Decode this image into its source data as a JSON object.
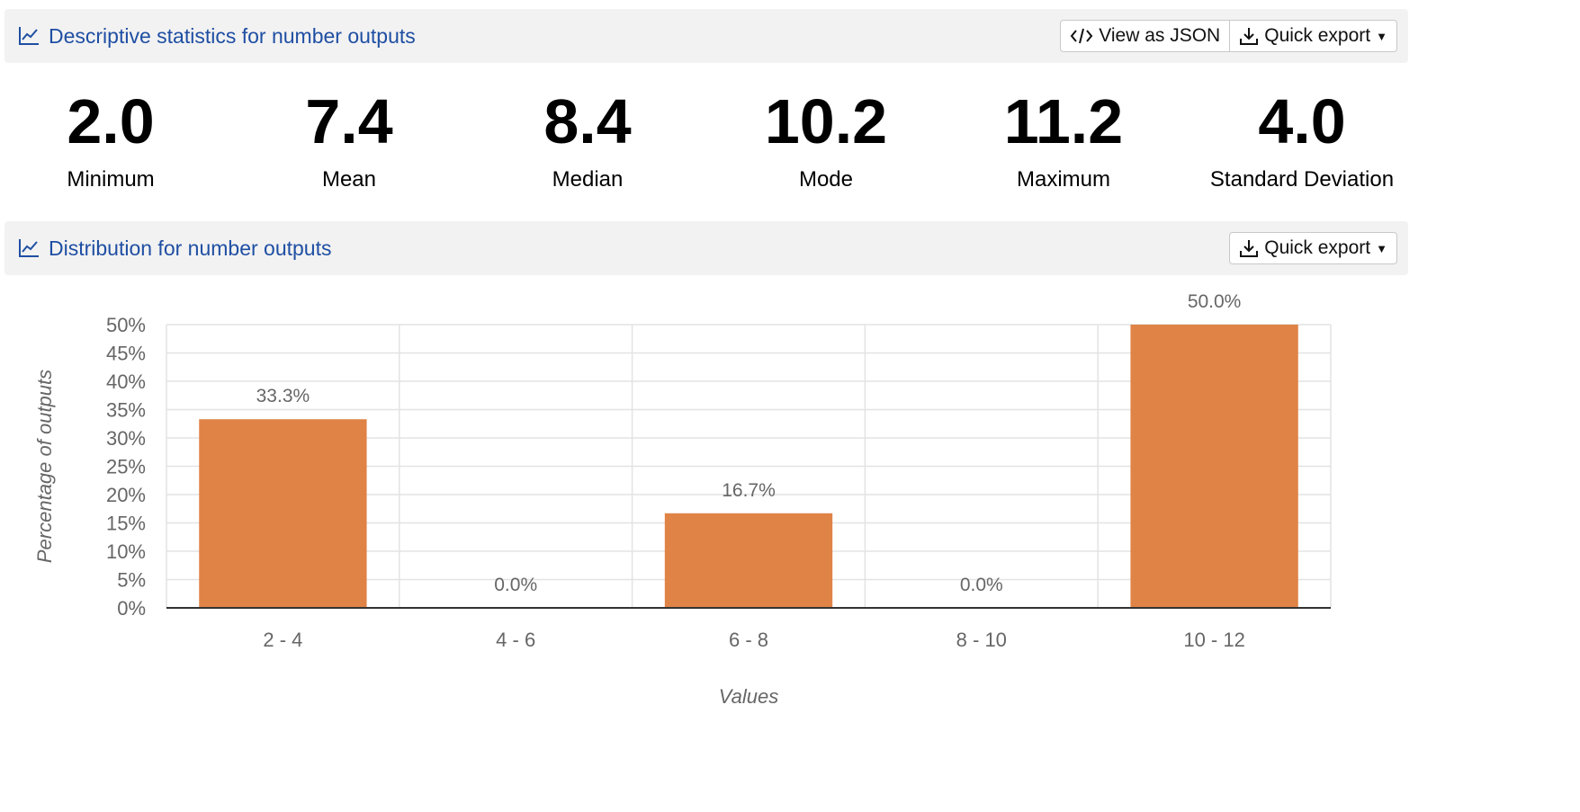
{
  "stats_panel": {
    "title": "Descriptive statistics for number outputs",
    "view_json_label": "View as JSON",
    "quick_export_label": "Quick export"
  },
  "stats": [
    {
      "value": "2.0",
      "label": "Minimum"
    },
    {
      "value": "7.4",
      "label": "Mean"
    },
    {
      "value": "8.4",
      "label": "Median"
    },
    {
      "value": "10.2",
      "label": "Mode"
    },
    {
      "value": "11.2",
      "label": "Maximum"
    },
    {
      "value": "4.0",
      "label": "Standard Deviation"
    }
  ],
  "distribution_panel": {
    "title": "Distribution for number outputs",
    "quick_export_label": "Quick export"
  },
  "colors": {
    "bar": "#e08347",
    "header_title": "#1f4fa3"
  },
  "icons": {
    "header": "line-chart-icon",
    "json": "code-icon",
    "export": "download-icon"
  },
  "chart_data": {
    "type": "bar",
    "categories": [
      "2 - 4",
      "4 - 6",
      "6 - 8",
      "8 - 10",
      "10 - 12"
    ],
    "values": [
      33.3,
      0.0,
      16.7,
      0.0,
      50.0
    ],
    "data_labels": [
      "33.3%",
      "0.0%",
      "16.7%",
      "0.0%",
      "50.0%"
    ],
    "xlabel": "Values",
    "ylabel": "Percentage of outputs",
    "ylim": [
      0,
      50
    ],
    "yticks": [
      "0%",
      "5%",
      "10%",
      "15%",
      "20%",
      "25%",
      "30%",
      "35%",
      "40%",
      "45%",
      "50%"
    ],
    "grid": true,
    "legend": "none"
  }
}
